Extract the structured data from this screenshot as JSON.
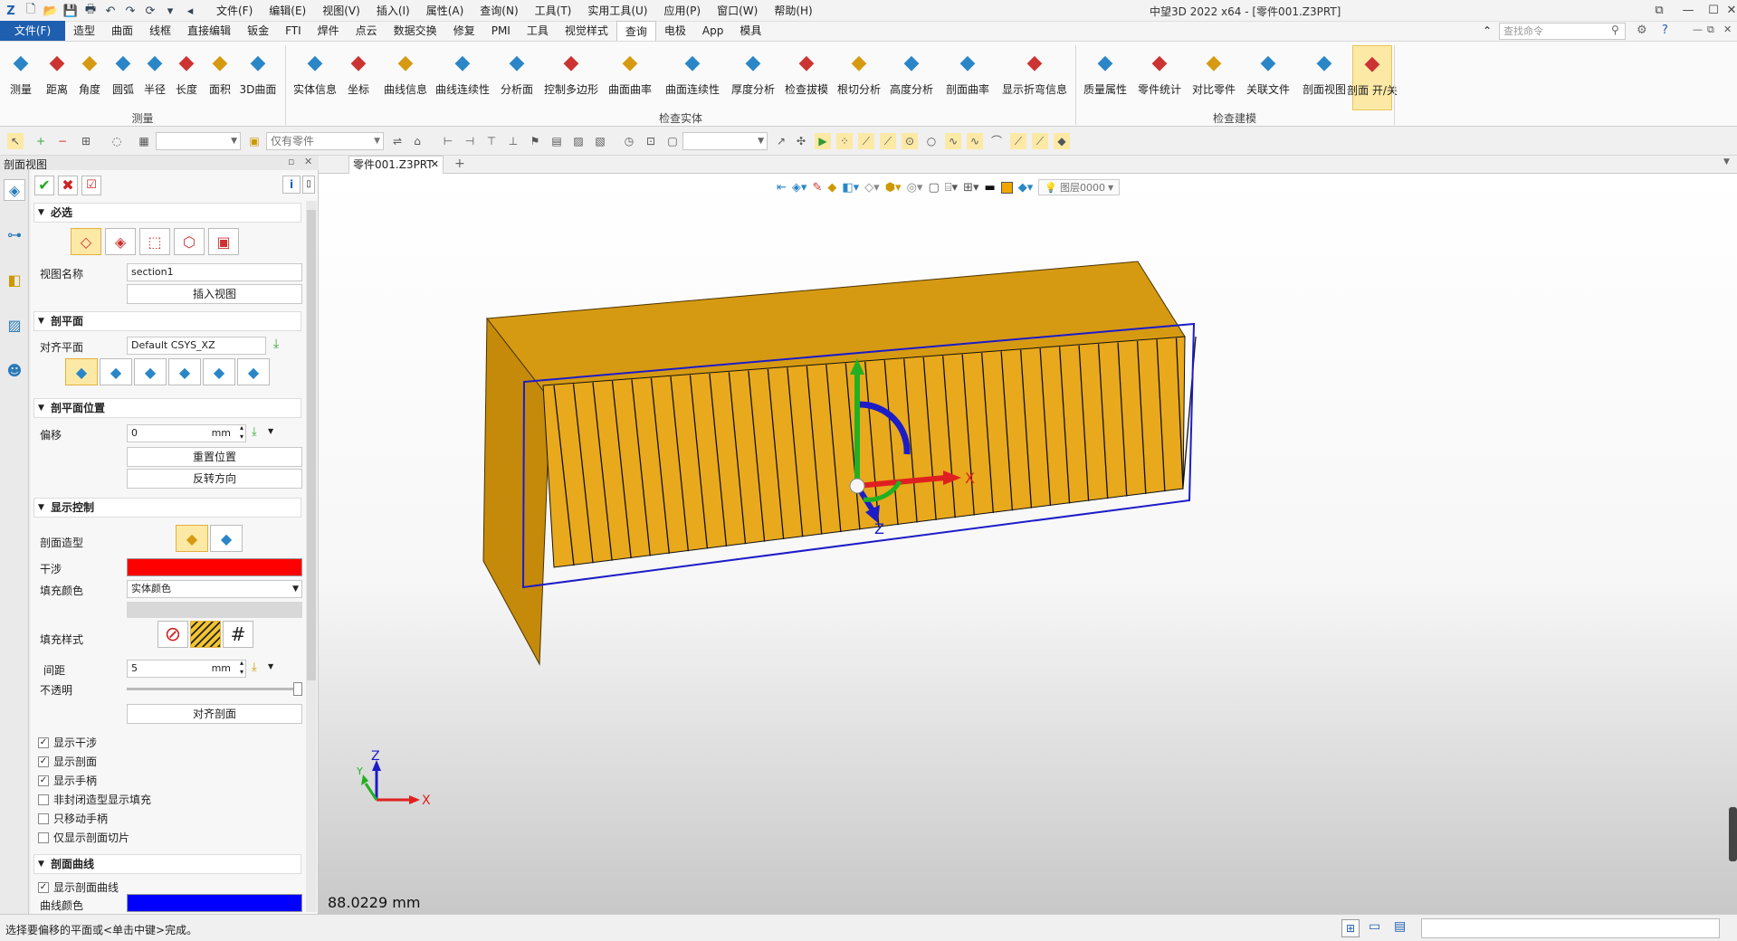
{
  "app": {
    "title": "中望3D 2022 x64 - [零件001.Z3PRT]"
  },
  "menu": {
    "items": [
      "文件(F)",
      "编辑(E)",
      "视图(V)",
      "插入(I)",
      "属性(A)",
      "查询(N)",
      "工具(T)",
      "实用工具(U)",
      "应用(P)",
      "窗口(W)",
      "帮助(H)"
    ]
  },
  "tabs": {
    "file": "文件(F)",
    "items": [
      "造型",
      "曲面",
      "线框",
      "直接编辑",
      "钣金",
      "FTI",
      "焊件",
      "点云",
      "数据交换",
      "修复",
      "PMI",
      "工具",
      "视觉样式",
      "查询",
      "电极",
      "App",
      "模具"
    ],
    "active_index": 13,
    "search_placeholder": "查找命令"
  },
  "ribbon": {
    "measure": {
      "label": "测量",
      "buttons": [
        "测量",
        "距离",
        "角度",
        "圆弧",
        "半径",
        "长度",
        "面积",
        "3D曲面"
      ]
    },
    "check_entity": {
      "label": "检查实体",
      "buttons": [
        "实体信息",
        "坐标",
        "曲线信息",
        "曲线连续性",
        "分析面",
        "控制多边形",
        "曲面曲率",
        "曲面连续性",
        "厚度分析",
        "检查拔模",
        "根切分析",
        "高度分析",
        "剖面曲率",
        "显示折弯信息"
      ]
    },
    "check_model": {
      "label": "检查建模",
      "buttons": [
        "质量属性",
        "零件统计",
        "对比零件",
        "关联文件",
        "剖面视图",
        "剖面 开/关"
      ]
    }
  },
  "toolbar": {
    "filter_value": "仅有零件"
  },
  "panel": {
    "title": "剖面视图",
    "required": {
      "header": "必选",
      "view_name_label": "视图名称",
      "view_name_value": "section1",
      "insert_view": "插入视图"
    },
    "section_plane": {
      "header": "剖平面",
      "align_label": "对齐平面",
      "align_value": "Default CSYS_XZ"
    },
    "plane_position": {
      "header": "剖平面位置",
      "offset_label": "偏移",
      "offset_value": "0",
      "offset_unit": "mm",
      "reset": "重置位置",
      "reverse": "反转方向"
    },
    "display": {
      "header": "显示控制",
      "shape_label": "剖面造型",
      "interference_label": "干涉",
      "interference_color": "#ff0000",
      "fill_color_label": "填充颜色",
      "fill_color_value": "实体颜色",
      "fill_style_label": "填充样式",
      "spacing_label": "间距",
      "spacing_value": "5",
      "spacing_unit": "mm",
      "opacity_label": "不透明",
      "align_section": "对齐剖面",
      "checks": [
        {
          "label": "显示干涉",
          "checked": true
        },
        {
          "label": "显示剖面",
          "checked": true
        },
        {
          "label": "显示手柄",
          "checked": true
        },
        {
          "label": "非封闭造型显示填充",
          "checked": false
        },
        {
          "label": "只移动手柄",
          "checked": false
        },
        {
          "label": "仅显示剖面切片",
          "checked": false
        }
      ]
    },
    "curves": {
      "header": "剖面曲线",
      "show_label": "显示剖面曲线",
      "show_checked": true,
      "color_label": "曲线颜色",
      "color": "#0000ff"
    }
  },
  "document": {
    "tab": "零件001.Z3PRT",
    "layer": "图层0000",
    "measure_readout": "88.0229 mm",
    "axis_x": "X",
    "axis_y": "Y",
    "axis_z": "Z"
  },
  "status": {
    "prompt": "选择要偏移的平面或<单击中键>完成。"
  },
  "colors": {
    "accent": "#1f5fb0",
    "part": "#e8a91c",
    "part_top": "#d69a12",
    "part_side": "#c78c0c"
  }
}
